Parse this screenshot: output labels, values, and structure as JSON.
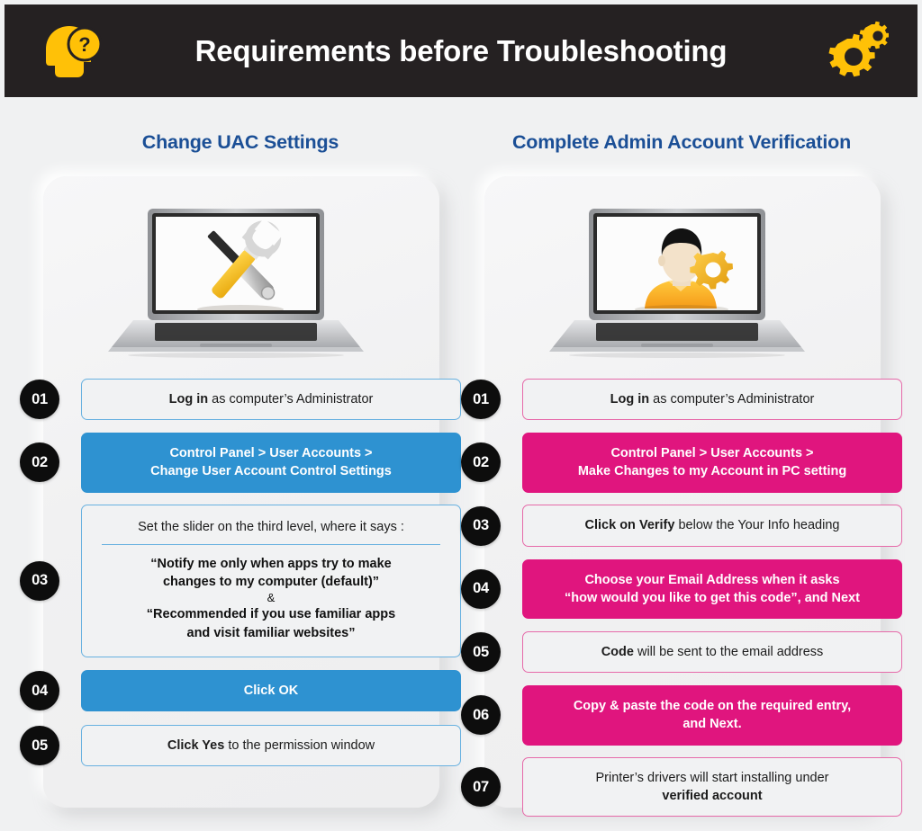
{
  "header": {
    "title": "Requirements before Troubleshooting",
    "left_icon": "head-question-icon",
    "right_icon": "gears-icon",
    "background_color": "#252122",
    "icon_color": "#ffc107",
    "title_color": "#ffffff"
  },
  "colors": {
    "page_background": "#f0f1f2",
    "heading_blue": "#1b4f96",
    "accent_blue": "#2e92d1",
    "accent_blue_border": "#68b1e0",
    "accent_pink": "#e0157e",
    "accent_pink_border": "#e66aa9",
    "badge_background": "#0d0d0d",
    "badge_text": "#ffffff",
    "pill_background": "#f1f2f3"
  },
  "columns": [
    {
      "id": "change-uac-settings",
      "heading": "Change UAC Settings",
      "illustration": "laptop-with-tools-icon",
      "accent": "blue",
      "steps": [
        {
          "number": "01",
          "style": "outline",
          "lines": [
            [
              {
                "text": "Log in",
                "bold": true
              },
              {
                "text": " as computer’s Administrator",
                "bold": false
              }
            ]
          ]
        },
        {
          "number": "02",
          "style": "solid",
          "lines": [
            [
              {
                "text": "Control Panel > User Accounts >",
                "bold": true
              }
            ],
            [
              {
                "text": "Change User Account Control Settings",
                "bold": true
              }
            ]
          ]
        },
        {
          "number": "03",
          "style": "outline-tall",
          "lead": "Set the slider on the third level, where it says :",
          "quote_lines": [
            "“Notify me only when apps try to make",
            "changes to my computer (default)”"
          ],
          "separator": "&",
          "quote_lines_2": [
            "“Recommended if you use familiar apps",
            "and visit familiar websites”"
          ]
        },
        {
          "number": "04",
          "style": "solid",
          "lines": [
            [
              {
                "text": "Click OK",
                "bold": true
              }
            ]
          ]
        },
        {
          "number": "05",
          "style": "outline",
          "lines": [
            [
              {
                "text": "Click Yes",
                "bold": true
              },
              {
                "text": " to the permission window",
                "bold": false
              }
            ]
          ]
        }
      ]
    },
    {
      "id": "complete-admin-account-verification",
      "heading": "Complete Admin Account Verification",
      "illustration": "laptop-with-user-gear-icon",
      "accent": "pink",
      "steps": [
        {
          "number": "01",
          "style": "outline",
          "lines": [
            [
              {
                "text": "Log in",
                "bold": true
              },
              {
                "text": " as computer’s Administrator",
                "bold": false
              }
            ]
          ]
        },
        {
          "number": "02",
          "style": "solid",
          "lines": [
            [
              {
                "text": "Control Panel > User Accounts >",
                "bold": true
              }
            ],
            [
              {
                "text": "Make Changes to my Account in PC setting",
                "bold": true
              }
            ]
          ]
        },
        {
          "number": "03",
          "style": "outline",
          "lines": [
            [
              {
                "text": "Click on Verify",
                "bold": true
              },
              {
                "text": " below the Your Info heading",
                "bold": false
              }
            ]
          ]
        },
        {
          "number": "04",
          "style": "solid",
          "lines": [
            [
              {
                "text": "Choose your Email Address",
                "bold": true
              },
              {
                "text": " when it asks",
                "bold": false
              }
            ],
            [
              {
                "text": "“how would you like to get this code”, and ",
                "bold": false
              },
              {
                "text": "Next",
                "bold": true
              }
            ]
          ]
        },
        {
          "number": "05",
          "style": "outline",
          "lines": [
            [
              {
                "text": "Code",
                "bold": true
              },
              {
                "text": " will be sent to the email address",
                "bold": false
              }
            ]
          ]
        },
        {
          "number": "06",
          "style": "solid",
          "lines": [
            [
              {
                "text": "Copy & paste the code",
                "bold": true
              },
              {
                "text": " on the required entry,",
                "bold": false
              }
            ],
            [
              {
                "text": "and ",
                "bold": false
              },
              {
                "text": "Next.",
                "bold": true
              }
            ]
          ]
        },
        {
          "number": "07",
          "style": "outline",
          "lines": [
            [
              {
                "text": "Printer’s drivers will start installing under",
                "bold": false
              }
            ],
            [
              {
                "text": "verified account",
                "bold": true
              }
            ]
          ]
        }
      ]
    }
  ]
}
